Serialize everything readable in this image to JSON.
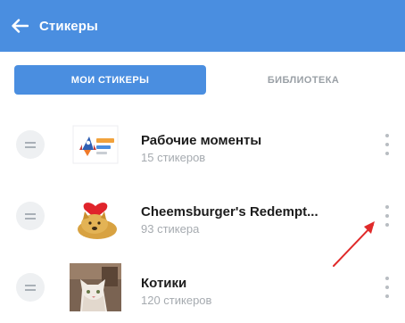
{
  "header": {
    "title": "Стикеры",
    "back_icon": "arrow-left-icon"
  },
  "tabs": [
    {
      "label": "МОИ СТИКЕРЫ",
      "active": true
    },
    {
      "label": "БИБЛИОТЕКА",
      "active": false
    }
  ],
  "sticker_sets": [
    {
      "name": "Рабочие моменты",
      "count": "15 стикеров",
      "thumbnail_icon": "rocket-sticker-icon"
    },
    {
      "name": "Cheemsburger's Redempt...",
      "count": "93 стикера",
      "thumbnail_icon": "cheems-dog-heart-sticker-icon"
    },
    {
      "name": "Котики",
      "count": "120 стикеров",
      "thumbnail_icon": "cat-photo-sticker-icon"
    }
  ],
  "colors": {
    "accent": "#4a8ee0",
    "annotation_arrow": "#e02a2a",
    "muted_text": "#a6abb0"
  }
}
